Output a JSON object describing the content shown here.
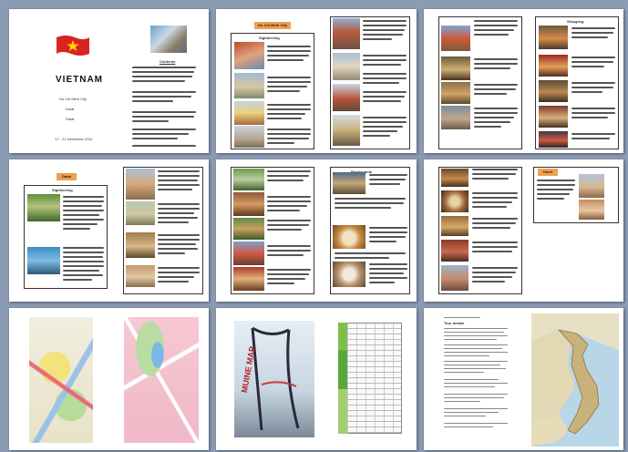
{
  "cover": {
    "title": "VIETNAM",
    "line1": "Ho Chi Minh City",
    "line2": "Dalat",
    "line3": "Dalat",
    "dates": "17 - 21 December 2011",
    "section_heading": "Contents"
  },
  "page2": {
    "heading": "Ho Chi Minh City",
    "sub_heading": "Sightseeing"
  },
  "page3": {
    "heading": "Hotels",
    "sub_heading": "Shopping"
  },
  "page4": {
    "heading": "Dalat",
    "sub_heading": "Sightseeing"
  },
  "page6": {
    "heading": "Hotel"
  },
  "page5": {
    "heading": "Restaurants"
  },
  "page8": {
    "map_label": "MUINE MAP"
  },
  "page9": {
    "heading": "Tour details"
  },
  "colors": {
    "background": "#8a9bb3",
    "accent_orange": "#f0a050",
    "flag_red": "#d8241f",
    "flag_star": "#ffd400"
  }
}
